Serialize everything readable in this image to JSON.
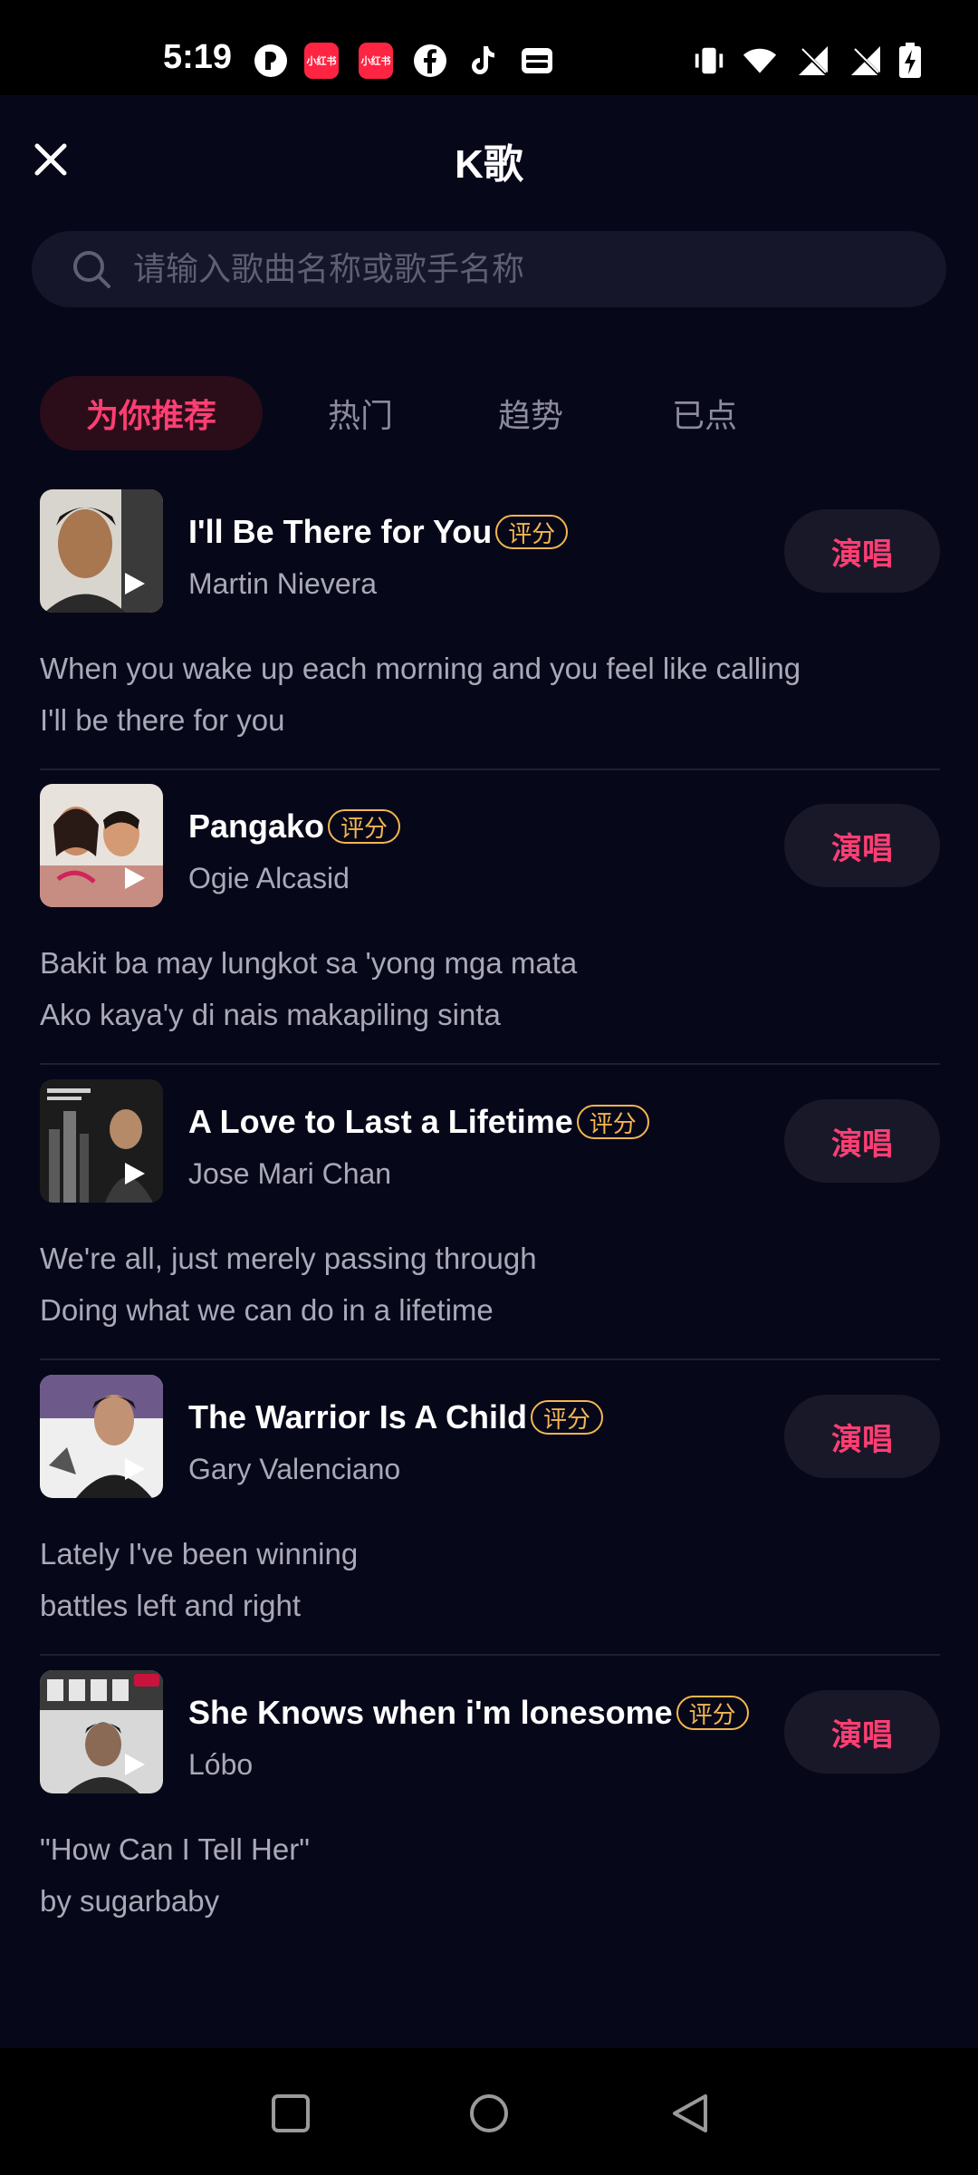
{
  "status_bar": {
    "time": "5:19",
    "left_icons": [
      "circle-p-icon",
      "xiaohongshu-icon",
      "xiaohongshu-icon",
      "facebook-icon",
      "tiktok-icon",
      "wallet-icon"
    ],
    "xhs_label": "小红书",
    "right_icons": [
      "vibrate-icon",
      "wifi-icon",
      "no-signal-icon",
      "no-signal-icon",
      "battery-charging-icon"
    ]
  },
  "header": {
    "title": "K歌",
    "close_icon": "close-icon"
  },
  "search": {
    "placeholder": "请输入歌曲名称或歌手名称",
    "icon": "search-icon"
  },
  "tabs": [
    {
      "label": "为你推荐",
      "active": true
    },
    {
      "label": "热门",
      "active": false
    },
    {
      "label": "趋势",
      "active": false
    },
    {
      "label": "已点",
      "active": false
    }
  ],
  "songs": [
    {
      "title": "I'll Be There for You",
      "badge": "评分",
      "artist": "Martin Nievera",
      "action": "演唱",
      "lyrics": [
        "When you wake up each morning and you feel like calling",
        "I'll be there for you"
      ]
    },
    {
      "title": "Pangako",
      "badge": "评分",
      "artist": "Ogie Alcasid",
      "action": "演唱",
      "lyrics": [
        "Bakit ba may lungkot sa 'yong mga mata",
        "Ako kaya'y di nais makapiling sinta"
      ]
    },
    {
      "title": "A Love to Last a Lifetime",
      "badge": "评分",
      "artist": "Jose Mari Chan",
      "action": "演唱",
      "lyrics": [
        "We're all, just merely passing through",
        "Doing what we can do in a lifetime"
      ]
    },
    {
      "title": "The Warrior Is A Child",
      "badge": "评分",
      "artist": "Gary Valenciano",
      "action": "演唱",
      "lyrics": [
        "Lately I've been winning",
        "battles left and right"
      ]
    },
    {
      "title": "She Knows when i'm lonesome",
      "badge": "评分",
      "artist": "Lóbo",
      "action": "演唱",
      "lyrics": [
        "\"How Can I Tell Her\"",
        "by sugarbaby"
      ]
    }
  ],
  "nav_bar": {
    "buttons": [
      "recents-square-icon",
      "home-circle-icon",
      "back-triangle-icon"
    ]
  },
  "colors": {
    "background": "#07071a",
    "accent": "#ff3e73",
    "badge": "#f3b64f",
    "secondary_text": "#a9a9b7"
  }
}
